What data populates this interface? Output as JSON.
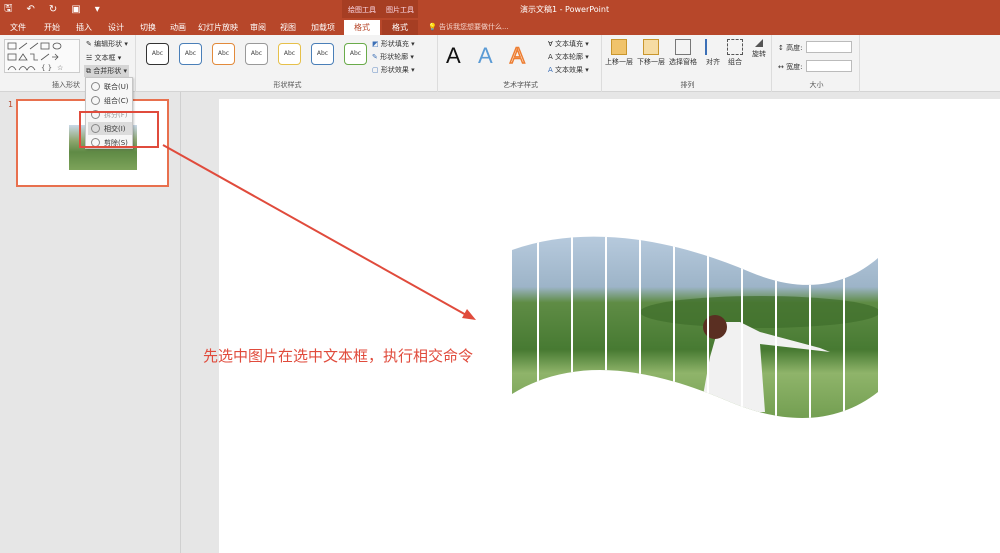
{
  "titlebar": {
    "doc_title": "演示文稿1 - PowerPoint",
    "ctx_drawing": "绘图工具",
    "ctx_picture": "图片工具"
  },
  "tabs": [
    "文件",
    "开始",
    "插入",
    "设计",
    "切换",
    "动画",
    "幻灯片放映",
    "审阅",
    "视图",
    "加载项",
    "格式",
    "格式"
  ],
  "tellme": "告诉我您想要做什么...",
  "ribbon": {
    "insert_shapes": {
      "label": "插入形状",
      "edit_shape": "编辑形状",
      "text_box": "文本框",
      "merge_shapes": "合并形状"
    },
    "shape_styles": {
      "label": "形状样式",
      "abc": "Abc",
      "fill": "形状填充",
      "outline": "形状轮廓",
      "effects": "形状效果"
    },
    "wordart": {
      "label": "艺术字样式",
      "letter": "A",
      "text_fill": "文本填充",
      "text_outline": "文本轮廓",
      "text_effects": "文本效果"
    },
    "arrange": {
      "label": "排列",
      "bring_forward": "上移一层",
      "send_backward": "下移一层",
      "selection_pane": "选择窗格",
      "align": "对齐",
      "group": "组合",
      "rotate": "旋转"
    },
    "size": {
      "label": "大小",
      "height": "高度:",
      "width": "宽度:"
    }
  },
  "merge_menu": {
    "items": [
      "联合(U)",
      "组合(C)",
      "拆分(F)",
      "相交(I)",
      "剪除(S)"
    ]
  },
  "slide_panel": {
    "number": "1"
  },
  "slide": {
    "caption": "先选中图片在选中文本框，执行相交命令"
  },
  "colors": {
    "accent": "#b7472a",
    "annotation": "#e04b3c"
  }
}
